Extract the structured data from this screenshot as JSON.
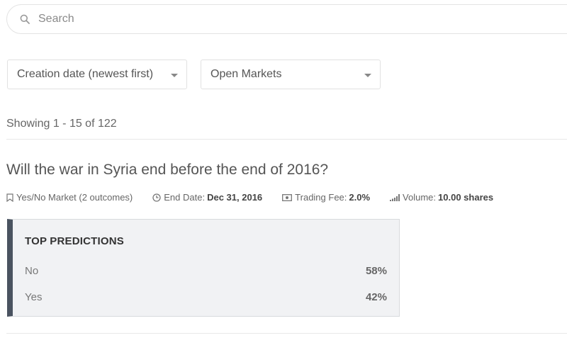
{
  "search": {
    "placeholder": "Search",
    "icon": "search-icon"
  },
  "filters": {
    "sort": {
      "selected": "Creation date (newest first)"
    },
    "status": {
      "selected": "Open Markets"
    }
  },
  "results": {
    "showing": "Showing 1 - 15 of 122"
  },
  "market": {
    "title": "Will the war in Syria end before the end of 2016?",
    "type": "Yes/No Market (2 outcomes)",
    "end_date_label": "End Date:",
    "end_date_value": "Dec 31, 2016",
    "fee_label": "Trading Fee:",
    "fee_value": "2.0%",
    "volume_label": "Volume:",
    "volume_value": "10.00 shares",
    "predictions": {
      "heading": "TOP PREDICTIONS",
      "rows": [
        {
          "label": "No",
          "percent": "58%"
        },
        {
          "label": "Yes",
          "percent": "42%"
        }
      ]
    }
  },
  "colors": {
    "accent_bar": "#4a5360",
    "panel_bg": "#f1f2f4"
  }
}
